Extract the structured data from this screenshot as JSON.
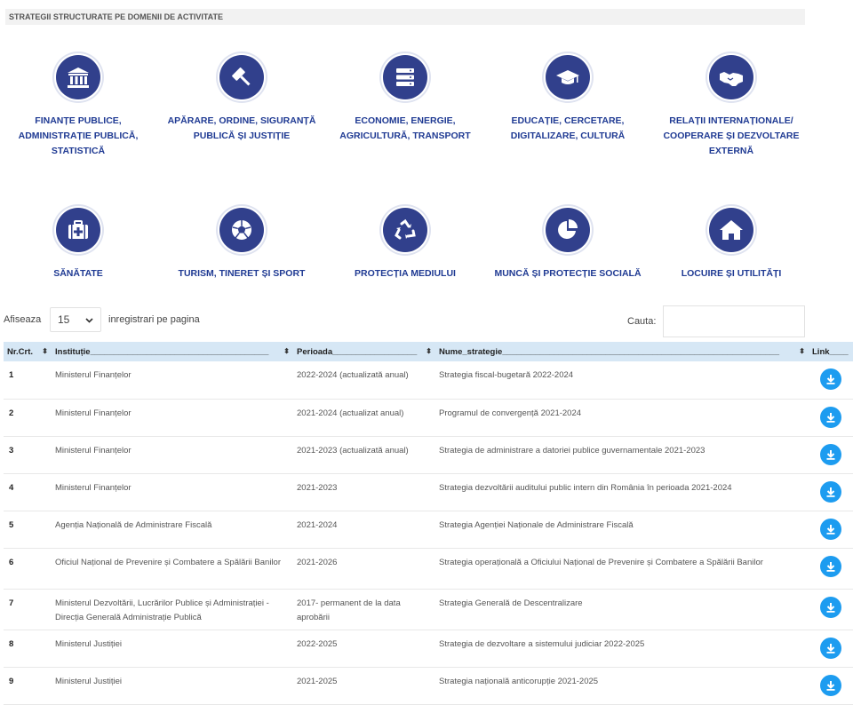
{
  "section_title": "STRATEGII STRUCTURATE PE DOMENII DE ACTIVITATE",
  "categories": [
    {
      "label": "FINANȚE PUBLICE, ADMINISTRAȚIE PUBLICĂ, STATISTICĂ",
      "icon": "bank-icon"
    },
    {
      "label": "APĂRARE, ORDINE, SIGURANȚĂ PUBLICĂ ȘI JUSTIȚIE",
      "icon": "gavel-icon"
    },
    {
      "label": "ECONOMIE, ENERGIE, AGRICULTURĂ, TRANSPORT",
      "icon": "server-icon"
    },
    {
      "label": "EDUCAȚIE, CERCETARE, DIGITALIZARE, CULTURĂ",
      "icon": "graduation-cap-icon"
    },
    {
      "label": "RELAȚII INTERNAȚIONALE/ COOPERARE ȘI DEZVOLTARE EXTERNĂ",
      "icon": "handshake-icon"
    },
    {
      "label": "SĂNĂTATE",
      "icon": "medkit-icon"
    },
    {
      "label": "TURISM, TINERET ȘI SPORT",
      "icon": "soccer-ball-icon"
    },
    {
      "label": "PROTECȚIA MEDIULUI",
      "icon": "recycle-icon"
    },
    {
      "label": "MUNCĂ ȘI PROTECȚIE SOCIALĂ",
      "icon": "pie-chart-icon"
    },
    {
      "label": "LOCUIRE ȘI UTILITĂȚI",
      "icon": "home-icon"
    }
  ],
  "controls": {
    "afiseaza": "Afiseaza",
    "page_size": "15",
    "inregistrari": "inregistrari pe pagina",
    "cauta": "Cauta:",
    "search_value": ""
  },
  "table": {
    "headers": [
      "Nr.Crt.",
      "Instituție______________________________________",
      "Perioada__________________",
      "Nume_strategie___________________________________________________________",
      "Link____"
    ],
    "rows": [
      {
        "nr": "1",
        "inst": "Ministerul Finanțelor",
        "per": "2022-2024 (actualizată anual)",
        "nume": "Strategia fiscal-bugetară 2022-2024"
      },
      {
        "nr": "2",
        "inst": "Ministerul Finanțelor",
        "per": "2021-2024 (actualizat anual)",
        "nume": "Programul de convergență 2021-2024"
      },
      {
        "nr": "3",
        "inst": "Ministerul Finanțelor",
        "per": "2021-2023 (actualizată anual)",
        "nume": "Strategia de administrare a datoriei publice guvernamentale 2021-2023"
      },
      {
        "nr": "4",
        "inst": "Ministerul Finanțelor",
        "per": "2021-2023",
        "nume": "Strategia dezvoltării auditului public intern din România în perioada 2021-2024"
      },
      {
        "nr": "5",
        "inst": "Agenția Națională de Administrare Fiscală",
        "per": "2021-2024",
        "nume": "Strategia Agenției Naționale de Administrare Fiscală"
      },
      {
        "nr": "6",
        "inst": "Oficiul Național de Prevenire și Combatere a Spălării Banilor",
        "per": "2021-2026",
        "nume": "Strategia operațională a Oficiului Național de Prevenire și Combatere a Spălării Banilor"
      },
      {
        "nr": "7",
        "inst": "Ministerul Dezvoltării, Lucrărilor Publice și Administrației - Direcția Generală Administrație Publică",
        "per": "2017- permanent de la data aprobării",
        "nume": "Strategia Generală de Descentralizare"
      },
      {
        "nr": "8",
        "inst": "Ministerul Justiției",
        "per": "2022-2025",
        "nume": "Strategia de dezvoltare a sistemului judiciar 2022-2025"
      },
      {
        "nr": "9",
        "inst": "Ministerul Justiției",
        "per": "2021-2025",
        "nume": "Strategia națională anticorupție 2021-2025"
      }
    ]
  },
  "colors": {
    "icon_bg": "#31408c",
    "label": "#1f3a93",
    "header_bg": "#d6e7f5",
    "download": "#1d9cf0"
  }
}
